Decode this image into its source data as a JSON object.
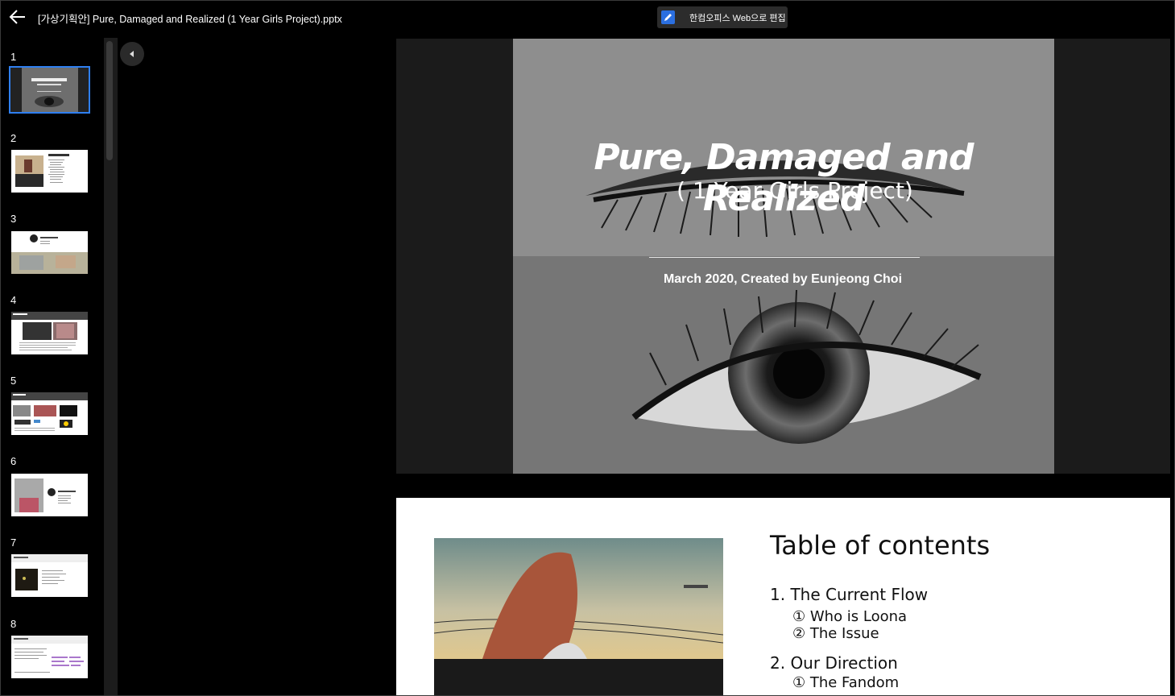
{
  "header": {
    "doc_title": "[가상기획안] Pure, Damaged and Realized (1 Year Girls Project).pptx",
    "edit_label": "한컴오피스 Web으로 편집"
  },
  "thumbnails": [
    {
      "num": "1"
    },
    {
      "num": "2"
    },
    {
      "num": "3"
    },
    {
      "num": "4"
    },
    {
      "num": "5"
    },
    {
      "num": "6"
    },
    {
      "num": "7"
    },
    {
      "num": "8"
    }
  ],
  "slide1": {
    "title": "Pure, Damaged and Realized",
    "subtitle": "( 1 Year Girls Project)",
    "credit": "March 2020, Created by Eunjeong Choi"
  },
  "slide2": {
    "title": "Table of contents",
    "items": [
      {
        "heading": "1.  The Current Flow",
        "subs": [
          "① Who is Loona",
          "② The Issue"
        ]
      },
      {
        "heading": "2.  Our Direction",
        "subs": [
          "① The Fandom"
        ]
      }
    ]
  },
  "colors": {
    "accent": "#2f7ff0",
    "edit_icon": "#2b6fe0"
  }
}
